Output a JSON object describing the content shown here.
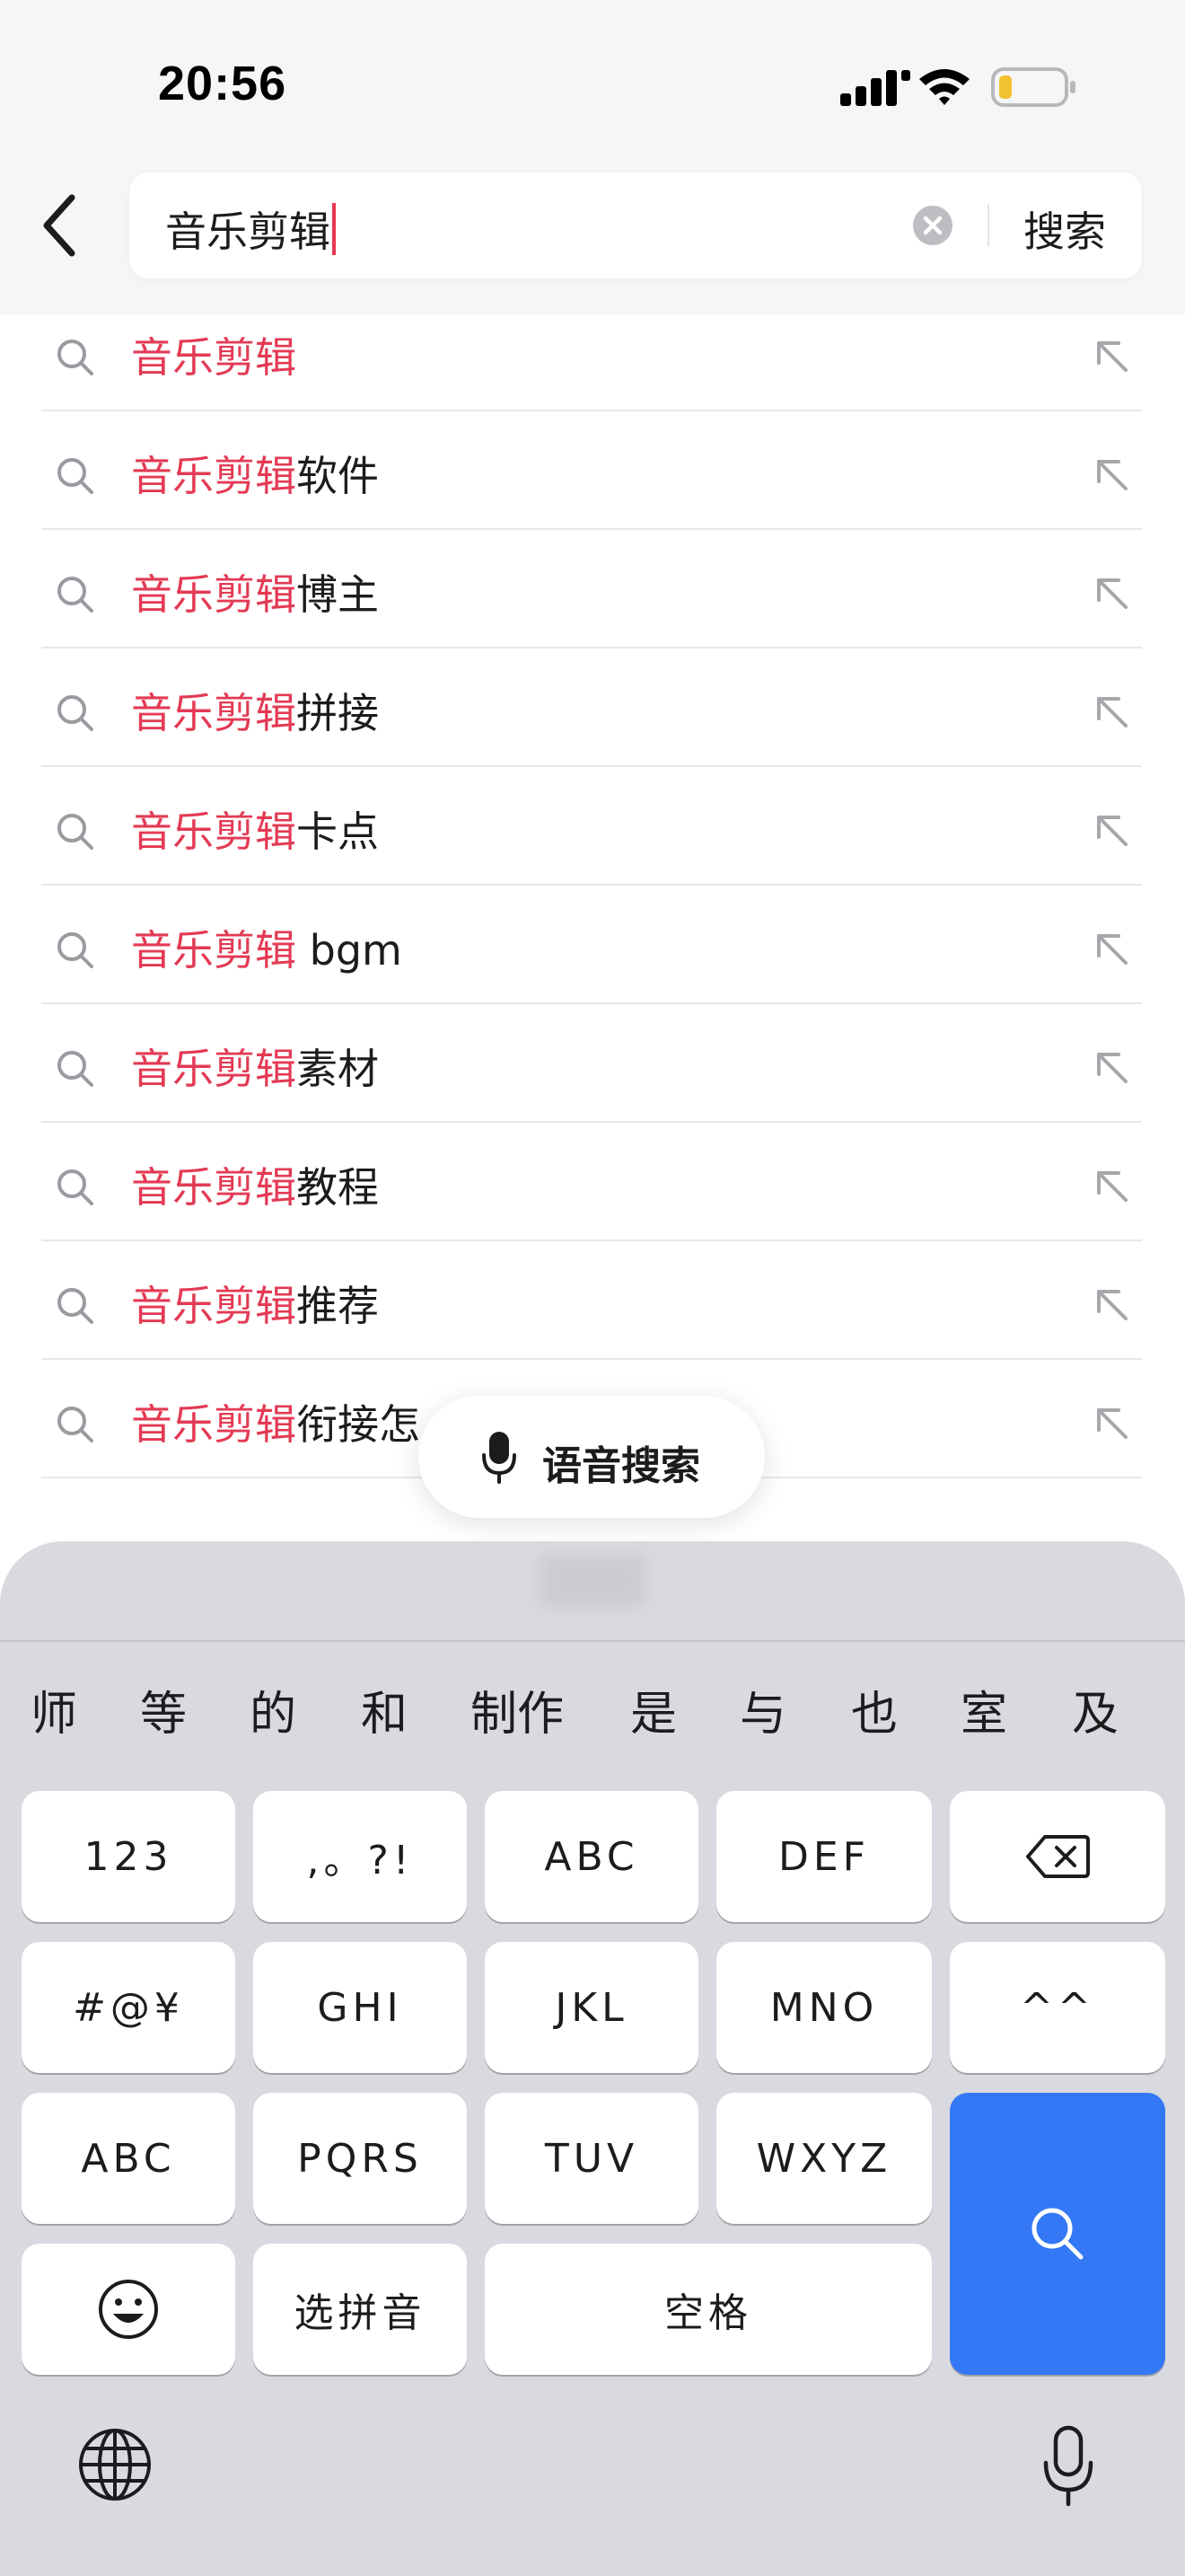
{
  "status_bar": {
    "time": "20:56"
  },
  "header": {
    "search_value": "音乐剪辑",
    "search_button": "搜索"
  },
  "suggestions": [
    {
      "highlight": "音乐剪辑",
      "rest": ""
    },
    {
      "highlight": "音乐剪辑",
      "rest": "软件"
    },
    {
      "highlight": "音乐剪辑",
      "rest": "博主"
    },
    {
      "highlight": "音乐剪辑",
      "rest": "拼接"
    },
    {
      "highlight": "音乐剪辑",
      "rest": "卡点"
    },
    {
      "highlight": "音乐剪辑",
      "rest": " bgm"
    },
    {
      "highlight": "音乐剪辑",
      "rest": "素材"
    },
    {
      "highlight": "音乐剪辑",
      "rest": "教程"
    },
    {
      "highlight": "音乐剪辑",
      "rest": "推荐"
    },
    {
      "highlight": "音乐剪辑",
      "rest": "衔接怎"
    }
  ],
  "voice_search": {
    "label": "语音搜索"
  },
  "keyboard": {
    "candidates": [
      "师",
      "等",
      "的",
      "和",
      "制作",
      "是",
      "与",
      "也",
      "室",
      "及"
    ],
    "keys": {
      "num": "123",
      "punct": ",。?!",
      "abc_top": "ABC",
      "def": "DEF",
      "symbols": "#@¥",
      "ghi": "GHI",
      "jkl": "JKL",
      "mno": "MNO",
      "emoticon": "^^",
      "abc_switch": "ABC",
      "pqrs": "PQRS",
      "tuv": "TUV",
      "wxyz": "WXYZ",
      "pinyin": "选拼音",
      "space": "空格"
    },
    "icons": [
      "delete-icon",
      "search-icon",
      "emoji-icon",
      "globe-icon",
      "microphone-icon"
    ]
  },
  "colors": {
    "highlight": "#e33a54",
    "accent": "#3478f6",
    "keyboard_bg": "#d9dadf"
  }
}
